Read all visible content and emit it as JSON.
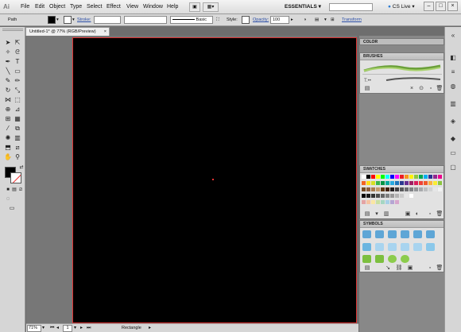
{
  "app": {
    "logo": "Ai"
  },
  "menu": {
    "items": [
      "File",
      "Edit",
      "Object",
      "Type",
      "Select",
      "Effect",
      "View",
      "Window",
      "Help"
    ],
    "workspace": "ESSENTIALS",
    "cs_live": "CS Live"
  },
  "control_bar": {
    "selection_label": "Path",
    "fill_color": "#000000",
    "stroke_label": "Stroke:",
    "brush_label": "Basic",
    "style_label": "Style:",
    "opacity_label": "Opacity:",
    "opacity_value": "100",
    "transform_label": "Transform"
  },
  "document": {
    "tab_title": "Untitled-1* @ 77% (RGB/Preview)",
    "artboard_color": "#000000",
    "artboard_border_color": "#dd3333"
  },
  "status_bar": {
    "zoom": "71%",
    "page": "1",
    "tool_mode": "Rectangle"
  },
  "panels": {
    "color": {
      "title": "COLOR"
    },
    "brushes": {
      "title": "BRUSHES"
    },
    "swatches": {
      "title": "SWATCHES",
      "row1": [
        "#ffffff",
        "#000000",
        "#ff0000",
        "#ffff00",
        "#00ff00",
        "#00ffff",
        "#0000ff",
        "#ff00ff",
        "#ed1c24",
        "#f7941d",
        "#fff200",
        "#8dc63f",
        "#00a651",
        "#00aeef",
        "#2e3192",
        "#92278f",
        "#ec008c"
      ],
      "row2": [
        "#f26522",
        "#ffde17",
        "#d7df23",
        "#39b54a",
        "#009444",
        "#00a99d",
        "#27aae1",
        "#1c75bc",
        "#2b3990",
        "#662d91",
        "#9e1f63",
        "#da1c5c",
        "#ef4136",
        "#f15a29",
        "#fbb040",
        "#f9ed32",
        "#8cc63f"
      ],
      "row3": [
        "#754c24",
        "#8b5e3c",
        "#a97c50",
        "#c49a6c",
        "#603913",
        "#42210b",
        "#231f20",
        "#414042",
        "#58595b",
        "#6d6e71",
        "#808285",
        "#939598",
        "#a7a9ac",
        "#bcbec0",
        "#d1d3d4",
        "#e6e7e8",
        "#f1f2f2"
      ],
      "row4": [
        "#000000",
        "#1a1a1a",
        "#333333",
        "#4d4d4d",
        "#666666",
        "#808080",
        "#999999",
        "#b3b3b3",
        "#cccccc",
        "#e6e6e6",
        "#ffffff"
      ],
      "row5": [
        "#e4a3a3",
        "#f6c3a1",
        "#fbe6a2",
        "#c8dfa1",
        "#a4d6c2",
        "#a6cfe7",
        "#b5a6d3",
        "#d7a6cc"
      ]
    },
    "symbols": {
      "title": "SYMBOLS"
    }
  },
  "colors": {
    "accent": "#2b4ea8",
    "artboard_mark": "#ee3333"
  }
}
